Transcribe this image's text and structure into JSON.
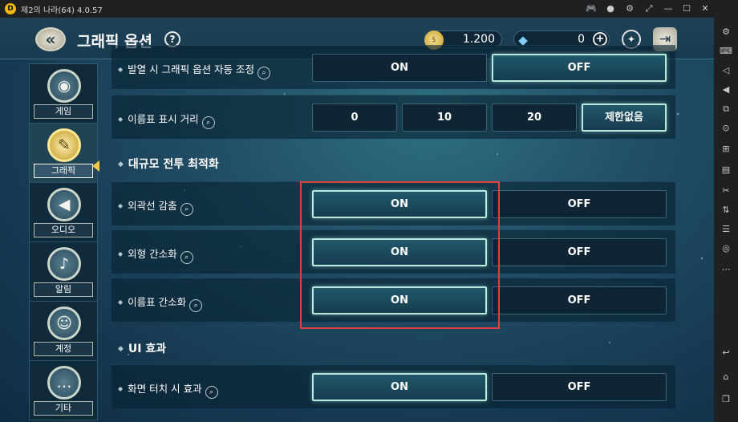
{
  "window": {
    "logo": "D",
    "title": "제2의 나라(64) 4.0.57"
  },
  "titlebar_icons": [
    "gamepad-icon",
    "account-icon",
    "settings-icon",
    "expand-icon",
    "minimize-icon",
    "maximize-icon",
    "close-icon"
  ],
  "header": {
    "back_icon": "«",
    "title": "그래픽 옵션",
    "help_icon": "?",
    "gold": {
      "icon": "$",
      "value": "1.200"
    },
    "gem": {
      "icon": "◆",
      "value": "0",
      "add_icon": "+"
    },
    "mission_icon": "✦",
    "exit_icon": "⇥"
  },
  "sidebar": [
    {
      "label": "게임",
      "icon": "gamepad-icon",
      "glyph": "◉"
    },
    {
      "label": "그래픽",
      "icon": "palette-icon",
      "glyph": "✎",
      "active": true
    },
    {
      "label": "오디오",
      "icon": "speaker-icon",
      "glyph": "◀"
    },
    {
      "label": "알림",
      "icon": "bell-icon",
      "glyph": "♪"
    },
    {
      "label": "계정",
      "icon": "user-icon",
      "glyph": "☺"
    },
    {
      "label": "기타",
      "icon": "more-icon",
      "glyph": "…"
    }
  ],
  "rows": [
    {
      "label": "발열 시 그래픽 옵션 자동 조정",
      "options": [
        "ON",
        "OFF"
      ],
      "selected": 1
    },
    {
      "label": "이름표 표시 거리",
      "options": [
        "0",
        "10",
        "20",
        "제한없음"
      ],
      "selected": 3
    },
    {
      "label": "외곽선 감춤",
      "options": [
        "ON",
        "OFF"
      ],
      "selected": 0
    },
    {
      "label": "외형 간소화",
      "options": [
        "ON",
        "OFF"
      ],
      "selected": 0
    },
    {
      "label": "이름표 간소화",
      "options": [
        "ON",
        "OFF"
      ],
      "selected": 0
    },
    {
      "label": "화면 터치 시 효과",
      "options": [
        "ON",
        "OFF"
      ],
      "selected": 0
    }
  ],
  "sections": {
    "large_battle": "대규모 전투 최적화",
    "ui_effects": "UI 효과"
  },
  "bullet": "◆",
  "mag_icon": "⌕",
  "annotation_color": "#d9423d",
  "accent_color": "#b7ecdc"
}
